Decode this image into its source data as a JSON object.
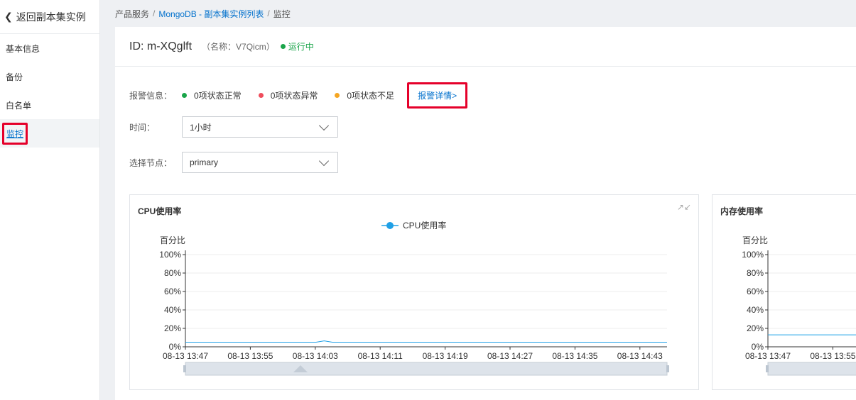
{
  "sidebar": {
    "back_label": "返回副本集实例",
    "items": [
      {
        "label": "基本信息"
      },
      {
        "label": "备份"
      },
      {
        "label": "白名单"
      },
      {
        "label": "监控"
      }
    ]
  },
  "breadcrumb": {
    "root": "产品服务",
    "list": "MongoDB - 副本集实例列表",
    "current": "监控"
  },
  "instance": {
    "id": "ID: m-XQglft",
    "name": "（名称：V7Qicm）",
    "status": "运行中",
    "status_color": "#1aa54a"
  },
  "alarm": {
    "label": "报警信息：",
    "normal": "0项状态正常",
    "abnormal": "0项状态异常",
    "insufficient": "0项状态不足",
    "detail_link": "报警详情>",
    "colors": {
      "normal": "#1aa54a",
      "abnormal": "#ef4d5c",
      "insufficient": "#f5a623"
    }
  },
  "time": {
    "label": "时间：",
    "value": "1小时"
  },
  "node": {
    "label": "选择节点：",
    "value": "primary"
  },
  "chart_data": [
    {
      "type": "line",
      "title": "CPU使用率",
      "ylabel": "百分比",
      "legend": "CPU使用率",
      "legend_position": "top-center",
      "ylim": [
        0,
        100
      ],
      "yticks": [
        "0%",
        "20%",
        "40%",
        "60%",
        "80%",
        "100%"
      ],
      "xticks": [
        "08-13 13:47",
        "08-13 13:55",
        "08-13 14:03",
        "08-13 14:11",
        "08-13 14:19",
        "08-13 14:27",
        "08-13 14:35",
        "08-13 14:43"
      ],
      "series": [
        {
          "name": "CPU使用率",
          "color": "#1fa0e6",
          "values": [
            5,
            5,
            5,
            5,
            5,
            5,
            5,
            5,
            5,
            5,
            5,
            5,
            5,
            5,
            5,
            5,
            5,
            6.5,
            5,
            5,
            5,
            5,
            5,
            5,
            5,
            5,
            5,
            5,
            5,
            5,
            5,
            5,
            5,
            5,
            5,
            5,
            5,
            5,
            5,
            5,
            5,
            5,
            5,
            5,
            5,
            5,
            5,
            5,
            5,
            5,
            5,
            5,
            5,
            5,
            5,
            5,
            5,
            5,
            5,
            5
          ]
        }
      ]
    },
    {
      "type": "line",
      "title": "内存使用率",
      "ylabel": "百分比",
      "ylim": [
        0,
        100
      ],
      "yticks": [
        "0%",
        "20%",
        "40%",
        "60%",
        "80%",
        "100%"
      ],
      "xticks": [
        "08-13 13:47",
        "08-13 13:55"
      ],
      "series": [
        {
          "color": "#1fa0e6",
          "values": [
            13,
            13,
            13,
            13,
            13,
            13,
            13,
            13,
            13,
            13,
            13,
            13,
            13,
            13,
            13,
            13,
            13,
            13,
            13,
            13
          ]
        }
      ]
    }
  ]
}
